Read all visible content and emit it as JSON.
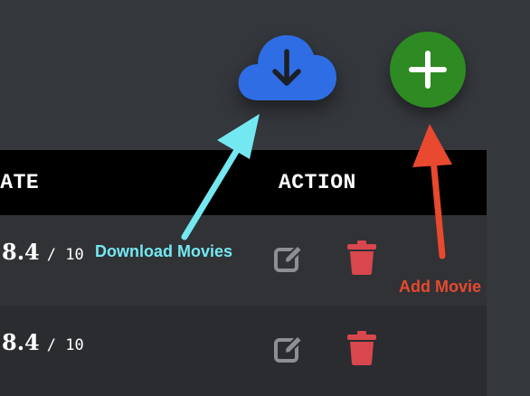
{
  "toolbar": {
    "download_icon": "cloud-download-icon",
    "add_icon": "plus-icon",
    "add_button_color": "#2e8a22",
    "download_color": "#2f6de4"
  },
  "table": {
    "columns": [
      "RATE",
      "ACTION"
    ],
    "rows": [
      {
        "rating": "8.4",
        "scale": "/ 10"
      },
      {
        "rating": "8.4",
        "scale": "/ 10"
      }
    ],
    "edit_icon": "edit-icon",
    "delete_icon": "trash-icon",
    "edit_color": "#8d8f92",
    "delete_color": "#d8474d"
  },
  "annotations": {
    "download_label": "Download Movies",
    "add_label": "Add Movie",
    "download_arrow_color": "#74e8f1",
    "add_arrow_color": "#e8492f"
  }
}
